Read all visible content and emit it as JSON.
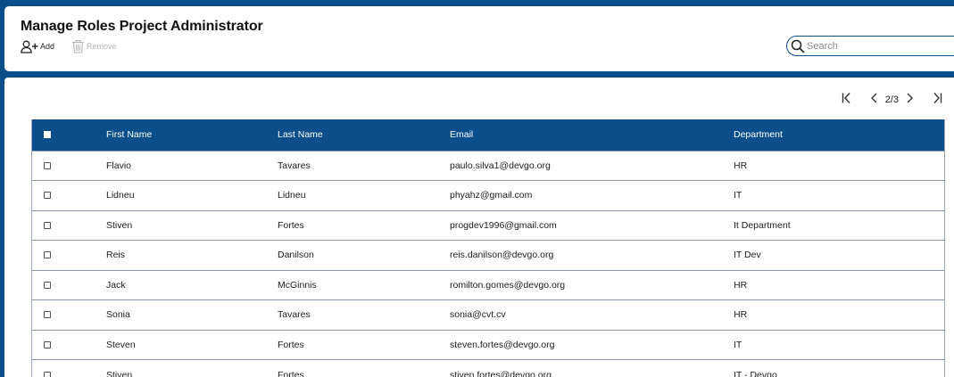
{
  "header": {
    "title": "Manage Roles Project Administrator",
    "add_label": "Add",
    "remove_label": "Remove"
  },
  "search": {
    "placeholder": "Search",
    "value": ""
  },
  "pager": {
    "page_label": "2/3"
  },
  "table": {
    "columns": [
      "First Name",
      "Last Name",
      "Email",
      "Department"
    ],
    "rows": [
      [
        "Flavio",
        "Tavares",
        "paulo.silva1@devgo.org",
        "HR"
      ],
      [
        "Lidneu",
        "Lidneu",
        "phyahz@gmail.com",
        "IT"
      ],
      [
        "Stiven",
        "Fortes",
        "progdev1996@gmail.com",
        "It Department"
      ],
      [
        "Reis",
        "Danilson",
        "reis.danilson@devgo.org",
        "IT Dev"
      ],
      [
        "Jack",
        "McGinnis",
        "romilton.gomes@devgo.org",
        "HR"
      ],
      [
        "Sonia",
        "Tavares",
        "sonia@cvt.cv",
        "HR"
      ],
      [
        "Steven",
        "Fortes",
        "steven.fortes@devgo.org",
        "IT"
      ],
      [
        "Stiven",
        "Fortes",
        "stiven.fortes@devgo.org",
        "IT - Devgo"
      ]
    ]
  },
  "colors": {
    "primary": "#0a4e8c",
    "disabled": "#b5b5b5"
  }
}
